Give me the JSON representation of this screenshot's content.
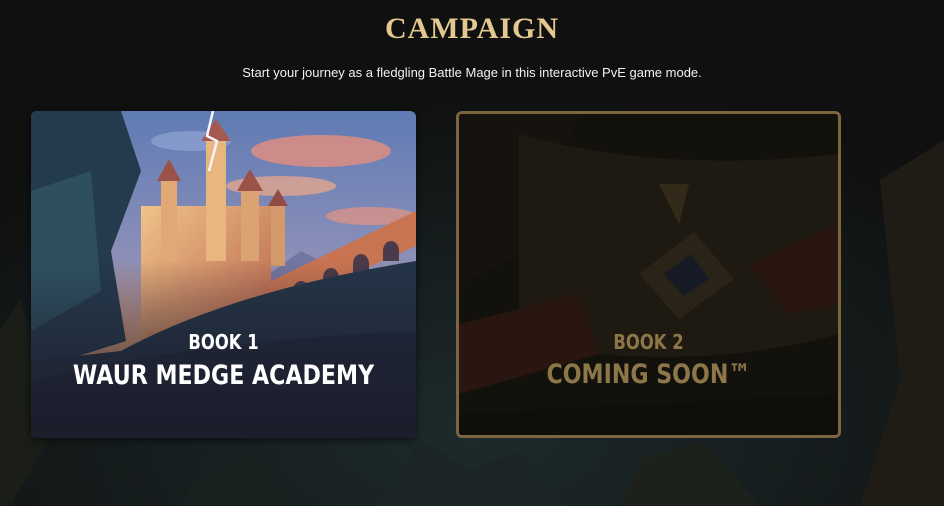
{
  "page": {
    "title": "CAMPAIGN",
    "subtitle": "Start your journey as a fledgling Battle Mage in this interactive PvE game mode."
  },
  "cards": [
    {
      "book_label": "BOOK 1",
      "book_name": "WAUR MEDGE ACADEMY",
      "state": "available"
    },
    {
      "book_label": "BOOK 2",
      "book_name": "COMING SOON™",
      "state": "locked"
    }
  ],
  "colors": {
    "title_gold": "#e3c88f",
    "locked_text": "#8d7648",
    "locked_border": "#7d6540",
    "background": "#0f100f"
  }
}
